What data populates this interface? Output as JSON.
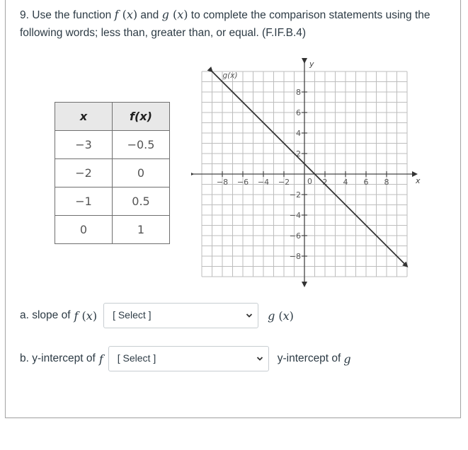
{
  "question": {
    "number": "9.",
    "text_pre": "Use the function",
    "f_name": "f",
    "g_name": "g",
    "arg": "x",
    "and": "and",
    "text_post": "to complete the comparison statements using the following words; less than, greater than, or equal. (F.IF.B.4)"
  },
  "table": {
    "headers": [
      "x",
      "f(x)"
    ],
    "rows": [
      [
        "−3",
        "−0.5"
      ],
      [
        "−2",
        "0"
      ],
      [
        "−1",
        "0.5"
      ],
      [
        "0",
        "1"
      ]
    ]
  },
  "chart_data": {
    "type": "line",
    "title": "",
    "xlabel": "x",
    "ylabel": "y",
    "xlim": [
      -10,
      10
    ],
    "ylim": [
      -10,
      10
    ],
    "grid": true,
    "x_ticks": [
      -8,
      -6,
      -4,
      -2,
      2,
      4,
      6,
      8
    ],
    "y_ticks": [
      8,
      6,
      4,
      2,
      -2,
      -4,
      -6,
      -8
    ],
    "origin_label": "0",
    "series": [
      {
        "name": "g(x)",
        "label": "g(x)",
        "slope": -1,
        "intercept": 1,
        "x": [
          -9,
          10
        ],
        "y": [
          10,
          -9
        ],
        "arrows": "both"
      }
    ]
  },
  "items": [
    {
      "prefix": "a.  slope of",
      "left_math": "f",
      "select": {
        "placeholder": "[ Select ]"
      },
      "right_math": "g",
      "arg": "x"
    },
    {
      "prefix": "b. y-intercept of",
      "left_math": "f",
      "select": {
        "placeholder": "[ Select ]"
      },
      "right_text": "y-intercept of",
      "right_math": "g"
    }
  ],
  "icons": {
    "select_chevron": "chevron-down-icon"
  }
}
